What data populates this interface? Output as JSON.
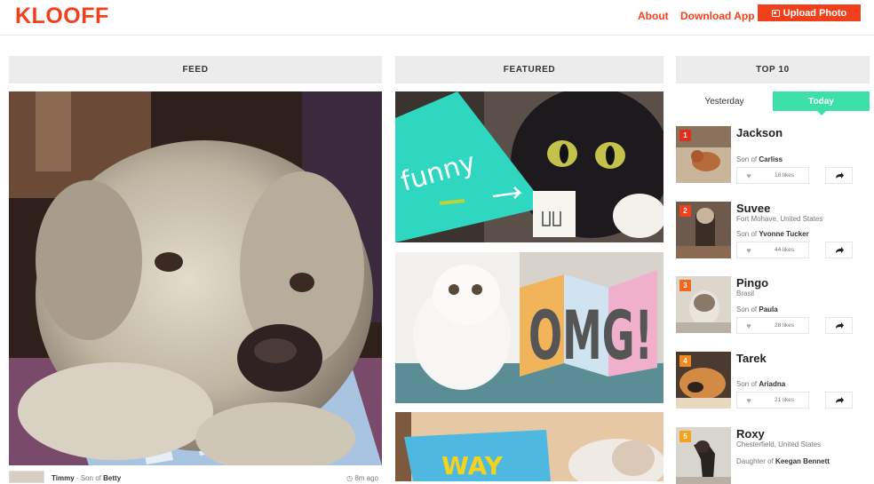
{
  "header": {
    "logo": "KLOOFF",
    "nav_about": "About",
    "nav_download": "Download App",
    "upload_label": "Upload Photo",
    "accent": "#f2401c"
  },
  "feed": {
    "heading": "FEED",
    "post": {
      "user": "Timmy",
      "relation": "Son of",
      "parent": "Betty",
      "time": "8m ago"
    }
  },
  "featured": {
    "heading": "FEATURED",
    "cards": [
      {
        "caption": "funny"
      },
      {
        "caption": "OMG!"
      },
      {
        "caption": "WAY"
      }
    ]
  },
  "top10": {
    "heading": "TOP 10",
    "tab_yesterday": "Yesterday",
    "tab_today": "Today",
    "active_tab": "Today",
    "tab_color": "#3de0a9",
    "entries": [
      {
        "rank": "1",
        "name": "Jackson",
        "location": "",
        "relation": "Son of",
        "parent": "Carliss",
        "likes": "18 likes",
        "badge_color": "#e0301c"
      },
      {
        "rank": "2",
        "name": "Suvee",
        "location": "Fort Mohave, United States",
        "relation": "Son of",
        "parent": "Yvonne Tucker",
        "likes": "44 likes",
        "badge_color": "#f2401c"
      },
      {
        "rank": "3",
        "name": "Pingo",
        "location": "Brasil",
        "relation": "Son of",
        "parent": "Paula",
        "likes": "28 likes",
        "badge_color": "#f36a1c"
      },
      {
        "rank": "4",
        "name": "Tarek",
        "location": "",
        "relation": "Son of",
        "parent": "Ariadna",
        "likes": "21 likes",
        "badge_color": "#f58a1c"
      },
      {
        "rank": "5",
        "name": "Roxy",
        "location": "Chesterfield, United States",
        "relation": "Daughter of",
        "parent": "Keegan Bennett",
        "likes": "",
        "badge_color": "#f5a21c"
      }
    ]
  }
}
